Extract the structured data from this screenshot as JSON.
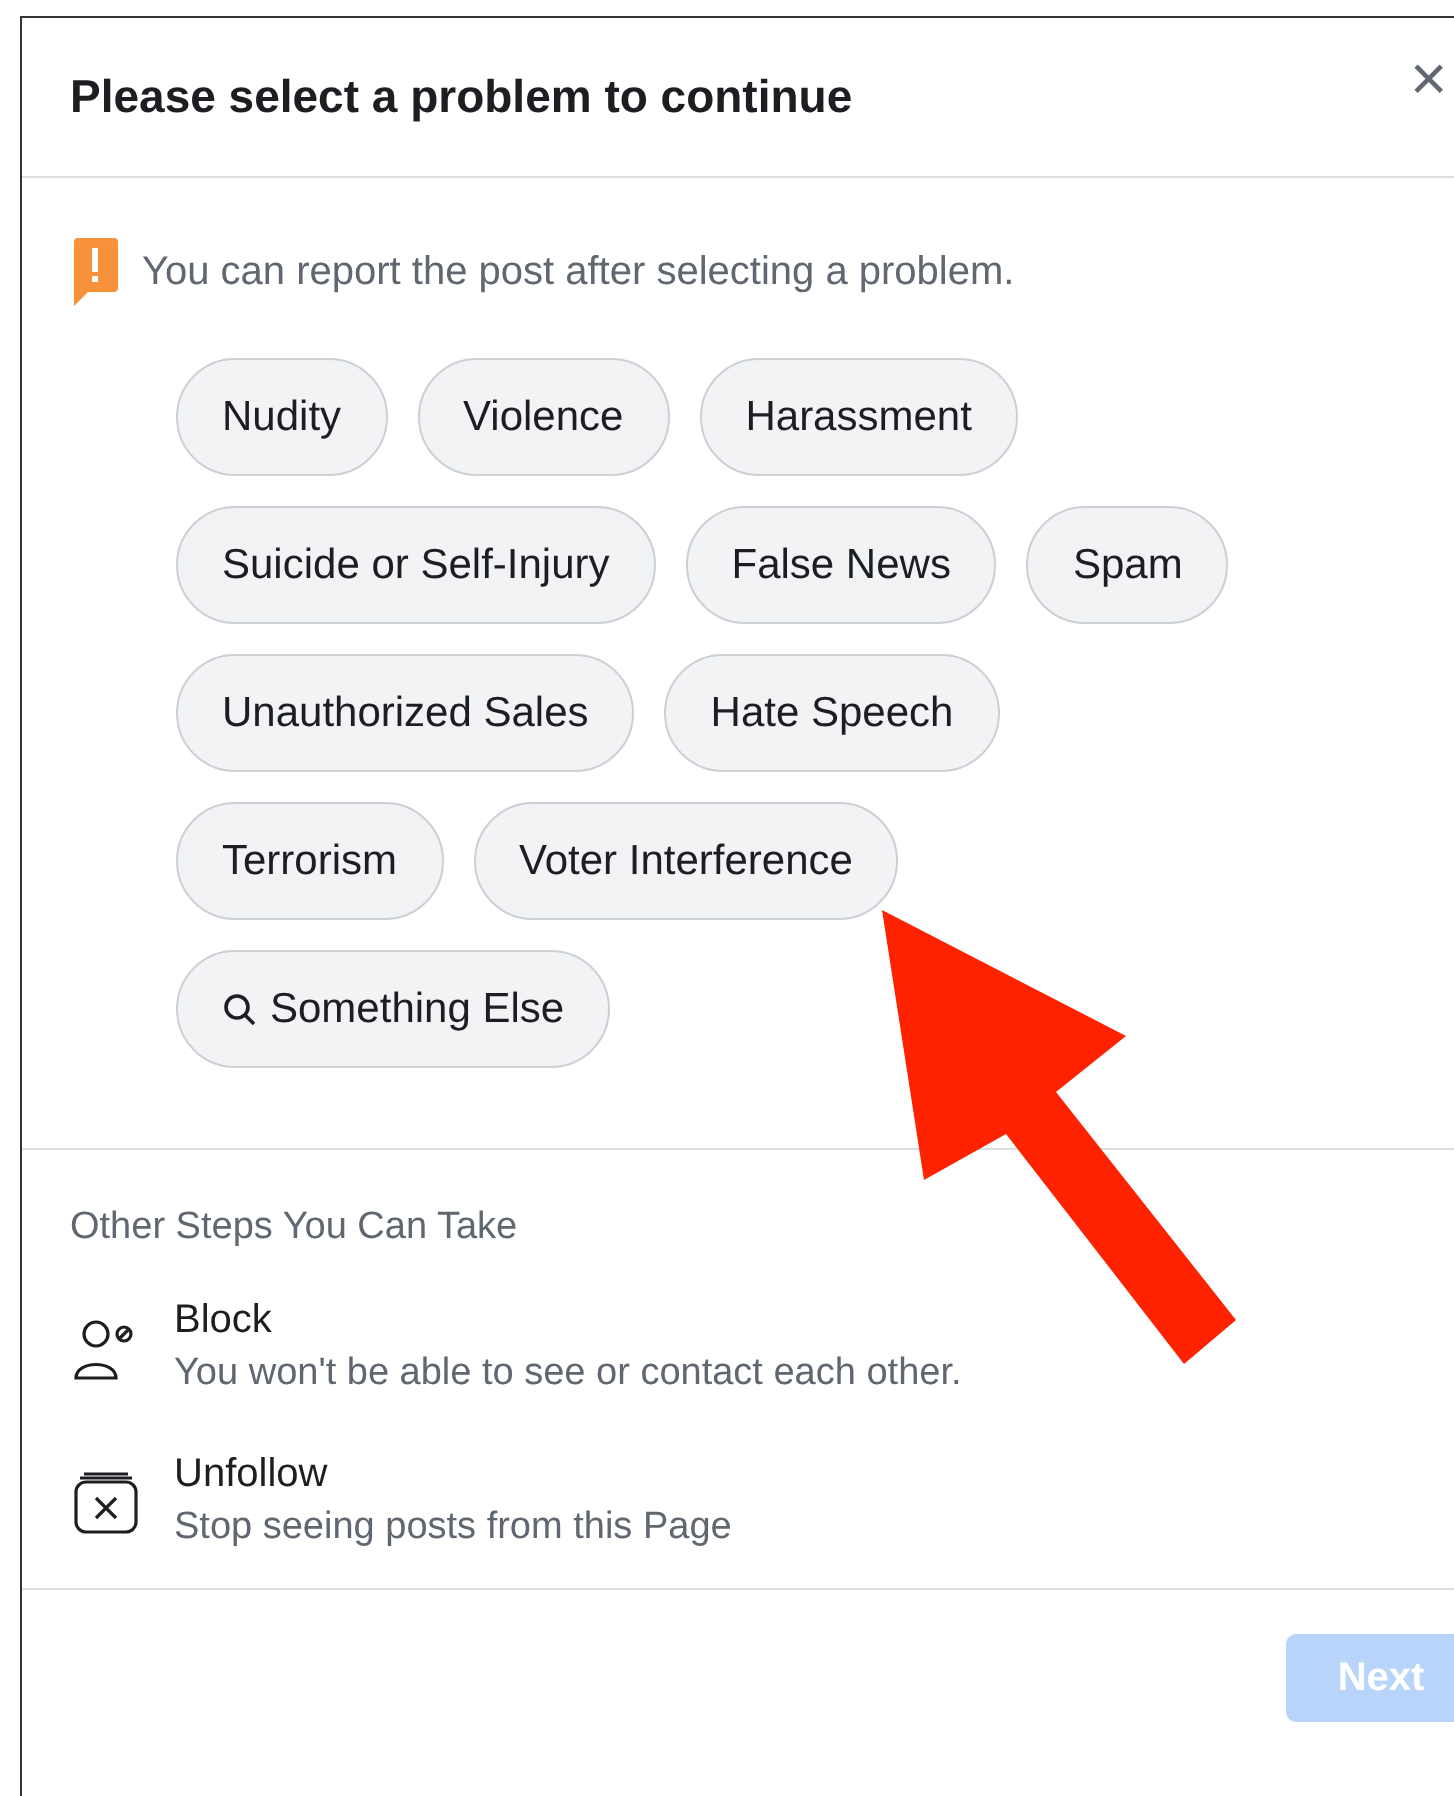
{
  "dialog": {
    "title": "Please select a problem to continue",
    "close": "×",
    "notice": "You can report the post after selecting a problem.",
    "problems": [
      {
        "label": "Nudity",
        "kind": "plain"
      },
      {
        "label": "Violence",
        "kind": "plain"
      },
      {
        "label": "Harassment",
        "kind": "plain"
      },
      {
        "label": "Suicide or Self-Injury",
        "kind": "plain"
      },
      {
        "label": "False News",
        "kind": "plain"
      },
      {
        "label": "Spam",
        "kind": "plain"
      },
      {
        "label": "Unauthorized Sales",
        "kind": "plain"
      },
      {
        "label": "Hate Speech",
        "kind": "plain"
      },
      {
        "label": "Terrorism",
        "kind": "plain"
      },
      {
        "label": "Voter Interference",
        "kind": "plain"
      },
      {
        "label": "Something Else",
        "kind": "search"
      }
    ],
    "other_steps": {
      "heading": "Other Steps You Can Take",
      "items": [
        {
          "kind": "block",
          "title": "Block",
          "subtitle": "You won't be able to see or contact each other."
        },
        {
          "kind": "unfollow",
          "title": "Unfollow",
          "subtitle": "Stop seeing posts from this Page"
        }
      ]
    },
    "next_button": {
      "label": "Next",
      "disabled": true
    }
  }
}
